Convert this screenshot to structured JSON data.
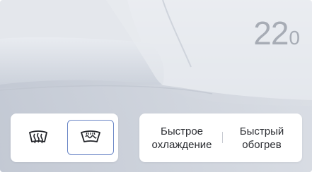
{
  "climate": {
    "temperature_int": "22",
    "temperature_dec": "0"
  },
  "defrost": {
    "rear_icon": "rear-defrost-icon",
    "front_icon": "front-defrost-icon",
    "front_active": true
  },
  "actions": {
    "quick_cool_line1": "Быстрое",
    "quick_cool_line2": "охлаждение",
    "quick_heat_line1": "Быстрый",
    "quick_heat_line2": "обогрев"
  },
  "colors": {
    "active_outline": "#6a86c6",
    "temperature_text": "#a7acb5",
    "panel_bg": "#ffffff"
  }
}
